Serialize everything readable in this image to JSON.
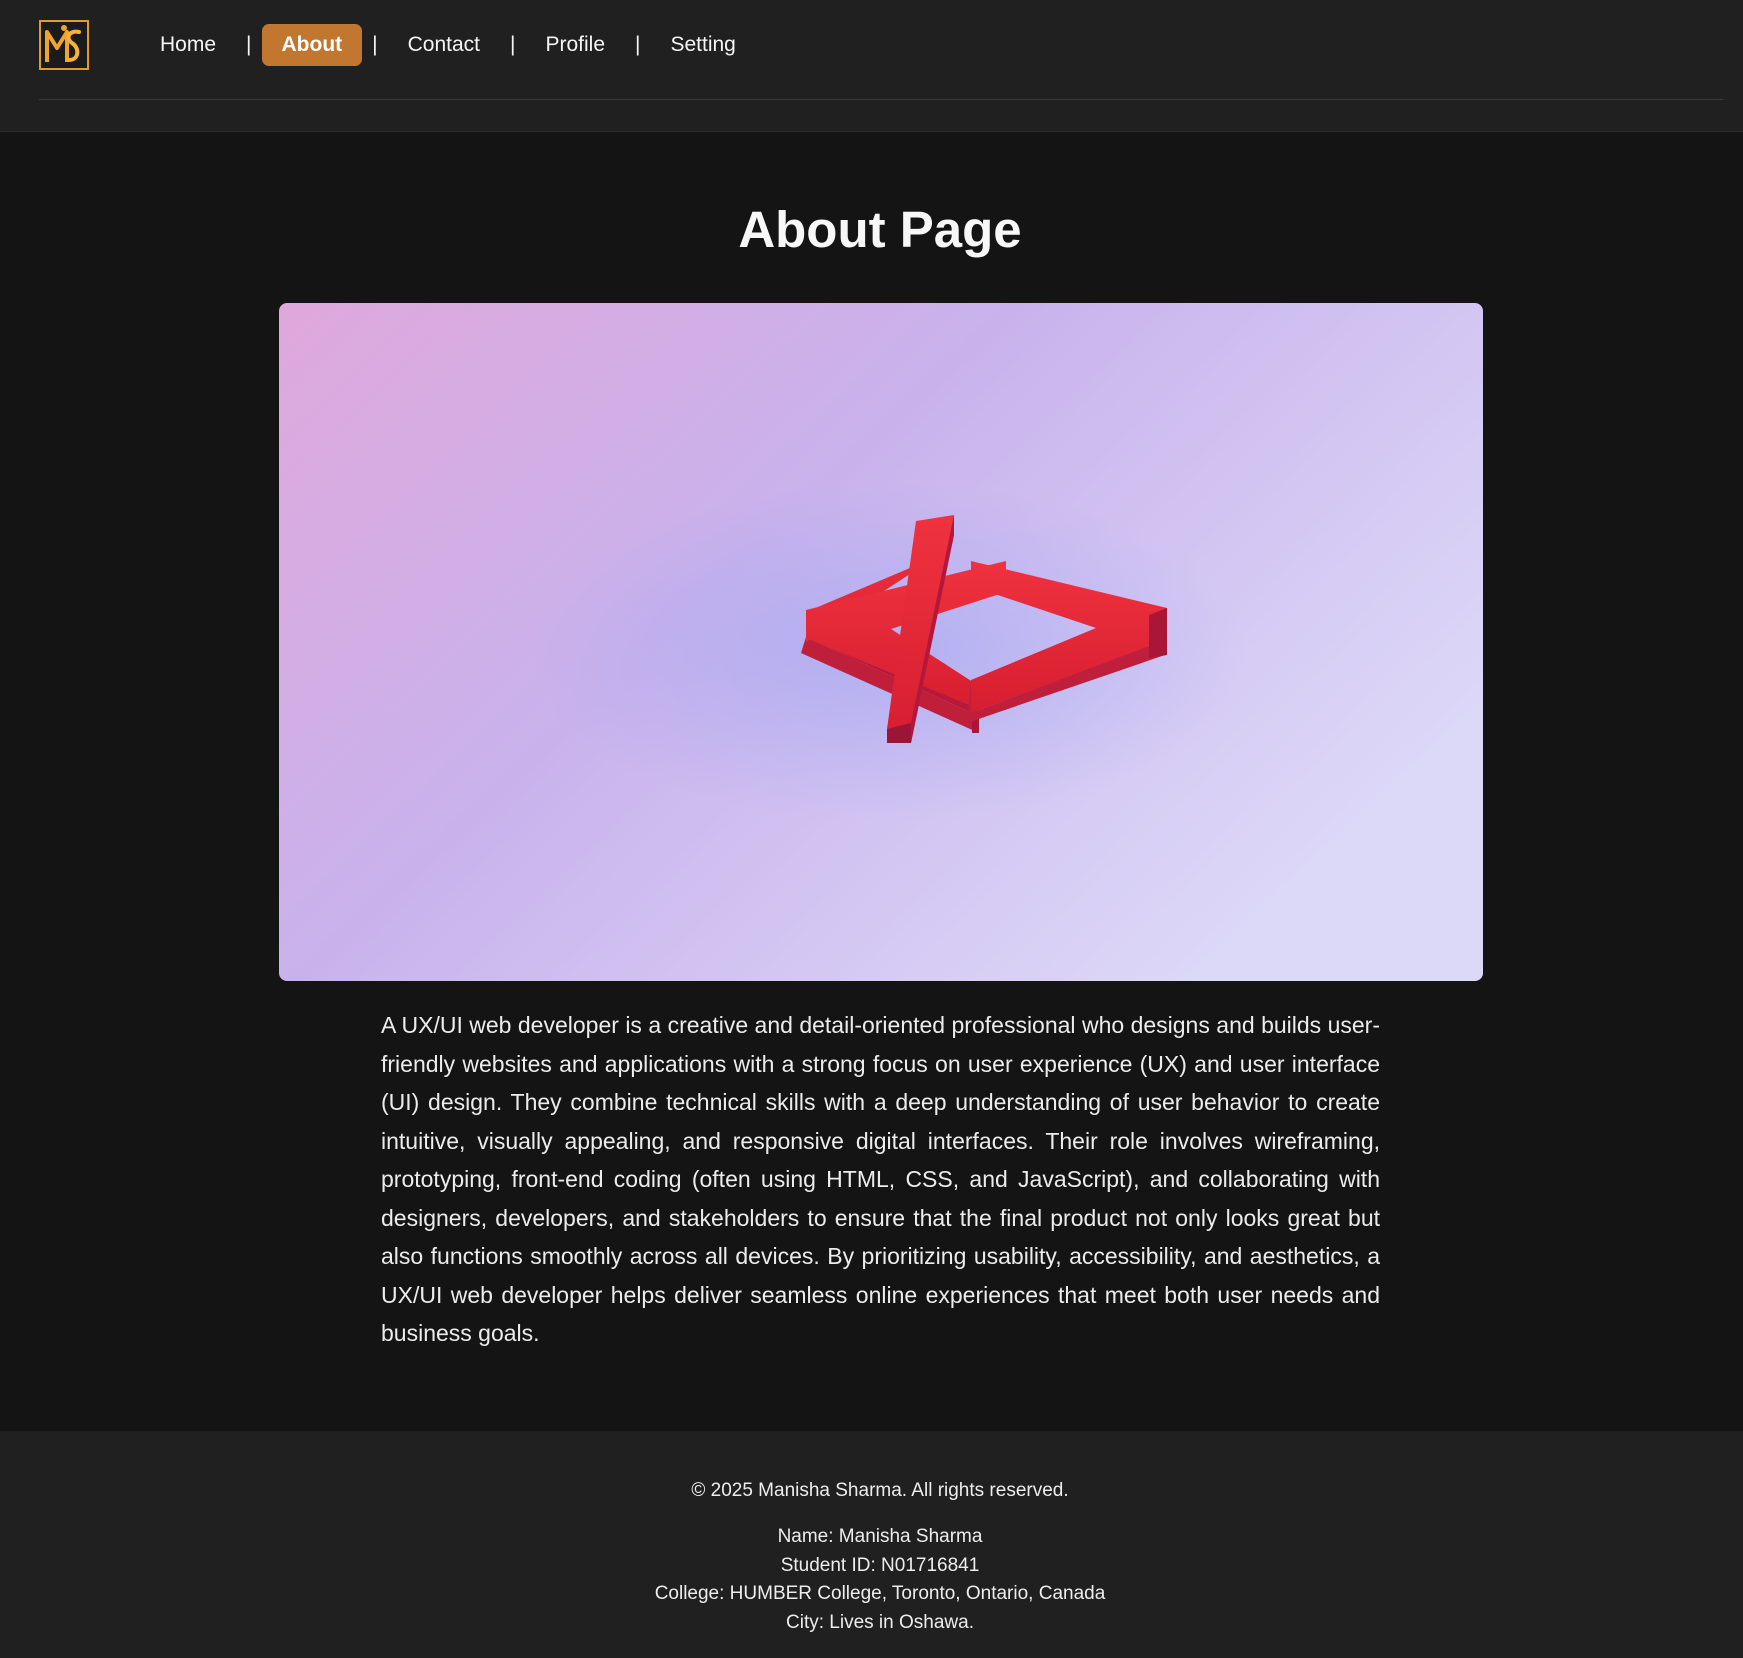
{
  "header": {
    "logo_icon": "ms-monogram-logo",
    "brand_color": "#c1772f",
    "nav": [
      {
        "label": "Home",
        "active": false
      },
      {
        "label": "About",
        "active": true
      },
      {
        "label": "Contact",
        "active": false
      },
      {
        "label": "Profile",
        "active": false
      },
      {
        "label": "Setting",
        "active": false
      }
    ],
    "separator": "|"
  },
  "main": {
    "title": "About Page",
    "hero_image": "code-brackets-3d-illustration",
    "paragraph": "A UX/UI web developer is a creative and detail-oriented professional who designs and builds user-friendly websites and applications with a strong focus on user experience (UX) and user interface (UI) design. They combine technical skills with a deep understanding of user behavior to create intuitive, visually appealing, and responsive digital interfaces. Their role involves wireframing, prototyping, front-end coding (often using HTML, CSS, and JavaScript), and collaborating with designers, developers, and stakeholders to ensure that the final product not only looks great but also functions smoothly across all devices. By prioritizing usability, accessibility, and aesthetics, a UX/UI web developer helps deliver seamless online experiences that meet both user needs and business goals."
  },
  "footer": {
    "copyright": "© 2025 Manisha Sharma. All rights reserved.",
    "name": "Name: Manisha Sharma",
    "student_id": "Student ID: N01716841",
    "college": "College: HUMBER College, Toronto, Ontario, Canada",
    "city": "City: Lives in Oshawa."
  }
}
